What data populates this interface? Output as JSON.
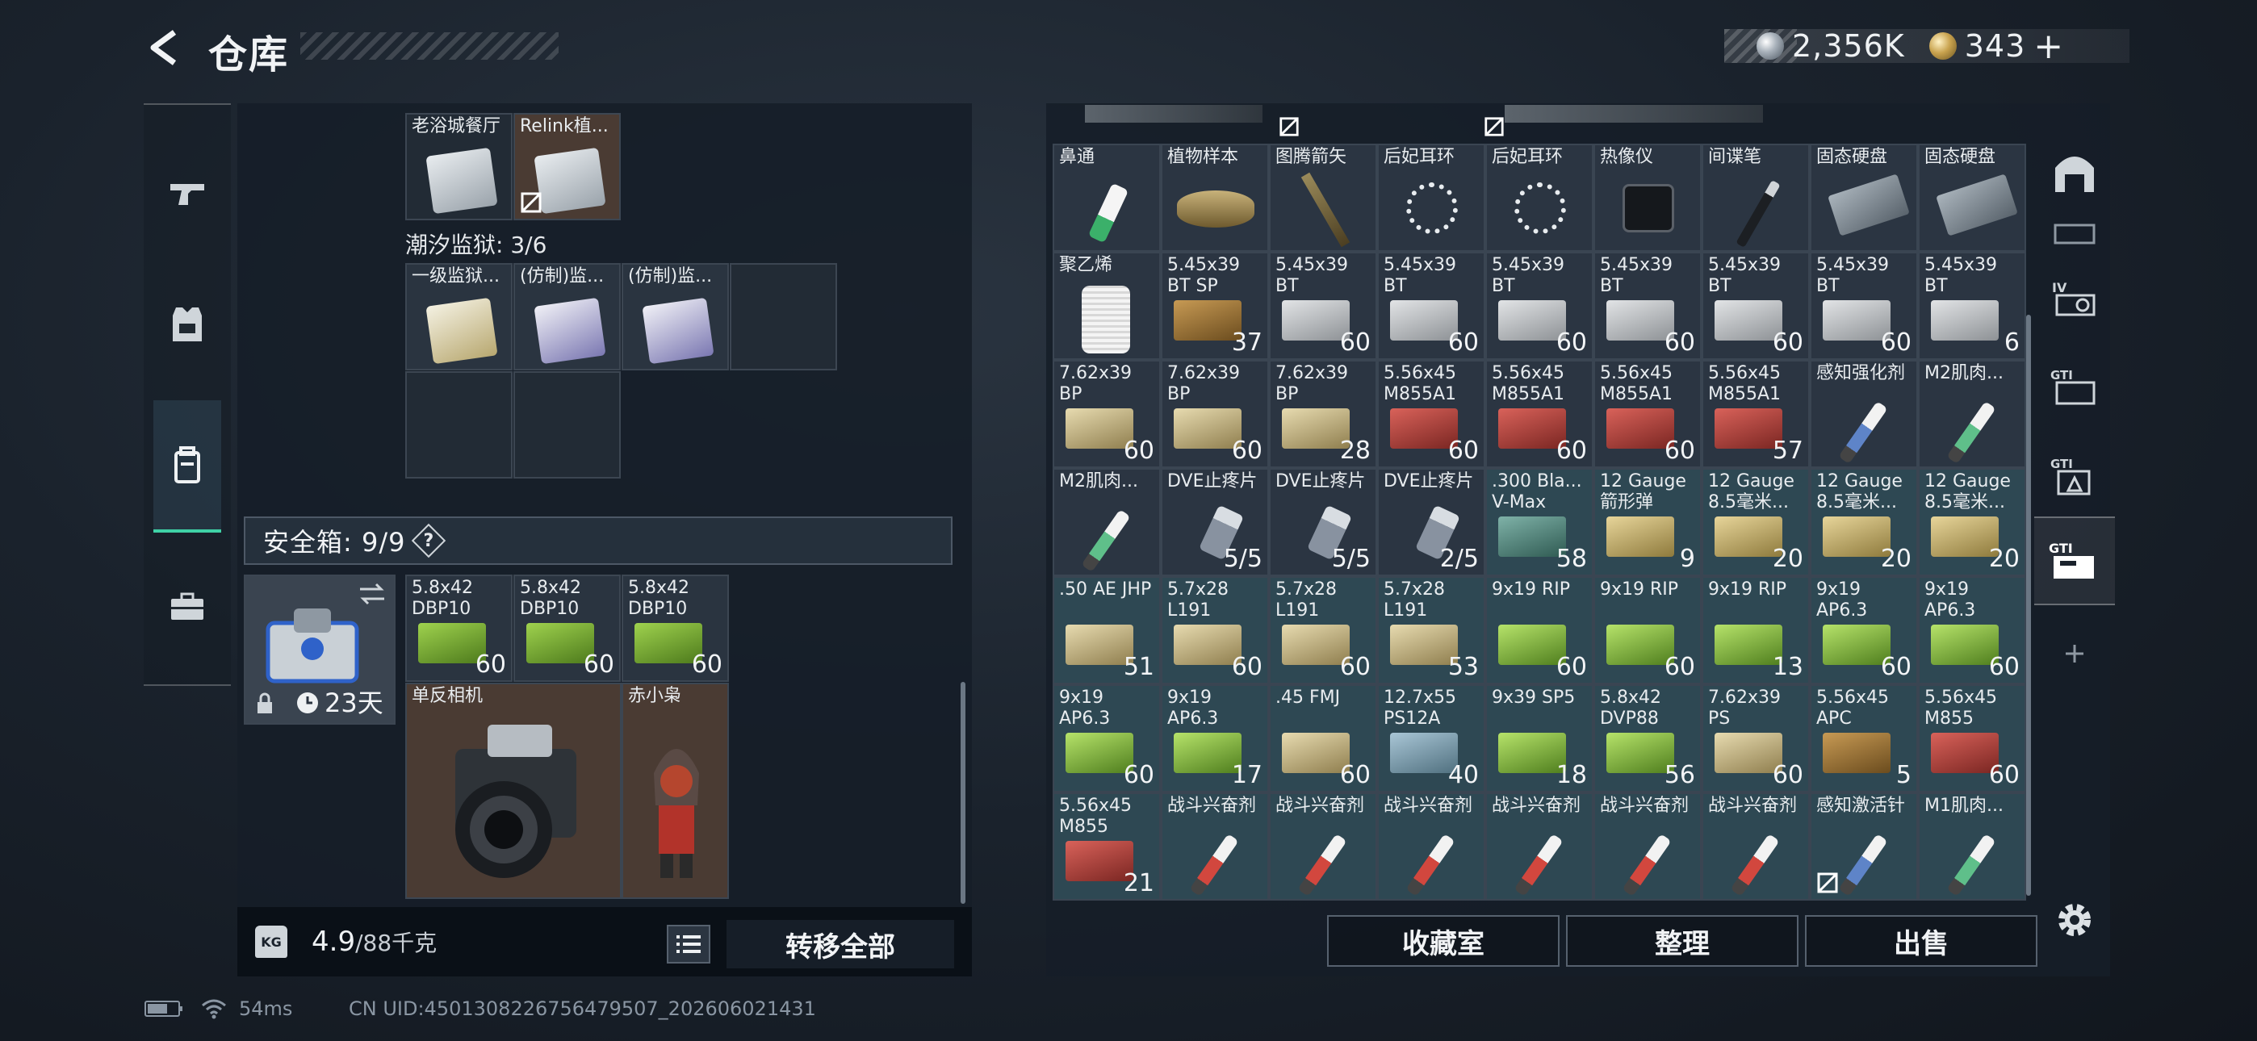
{
  "header": {
    "title": "仓库",
    "currency_silver": "2,356K",
    "currency_gold": "343",
    "plus": "+"
  },
  "left_sidebar": {
    "items": [
      {
        "icon": "pistol-icon"
      },
      {
        "icon": "armor-vest-icon"
      },
      {
        "icon": "backpack-icon",
        "active": true
      },
      {
        "icon": "briefcase-icon"
      }
    ]
  },
  "left": {
    "row1": [
      {
        "name": "老浴城餐厅",
        "bg": "blank"
      },
      {
        "name": "Relink植...",
        "bg": "brown",
        "blocked": true
      }
    ],
    "prison_label": "潮汐监狱: 3/6",
    "prison": [
      {
        "name": "一级监狱..."
      },
      {
        "name": "(仿制)监..."
      },
      {
        "name": "(仿制)监..."
      }
    ],
    "safebox_label": "安全箱: 9/9",
    "safebox_help": "?",
    "safebox_timer": "23天",
    "safe_items_row1": [
      {
        "name": "5.8x42 DBP10",
        "count": "60"
      },
      {
        "name": "5.8x42 DBP10",
        "count": "60"
      },
      {
        "name": "5.8x42 DBP10",
        "count": "60"
      }
    ],
    "camera": "单反相机",
    "figure": "赤小枭"
  },
  "bottom": {
    "weight_value": "4.9",
    "weight_max": "/88千克",
    "transfer_all": "转移全部",
    "kg": "KG"
  },
  "right": {
    "rows": [
      [
        {
          "name": "鼻通",
          "count": "",
          "kind": "bottle"
        },
        {
          "name": "植物样本",
          "count": "",
          "kind": "jar"
        },
        {
          "name": "图腾箭矢",
          "count": "",
          "kind": "arrow"
        },
        {
          "name": "后妃耳环",
          "count": "",
          "kind": "earring"
        },
        {
          "name": "后妃耳环",
          "count": "",
          "kind": "earring"
        },
        {
          "name": "热像仪",
          "count": "",
          "kind": "thermal"
        },
        {
          "name": "间谍笔",
          "count": "",
          "kind": "pen"
        },
        {
          "name": "固态硬盘",
          "count": "",
          "kind": "disk"
        },
        {
          "name": "固态硬盘",
          "count": "",
          "kind": "disk"
        }
      ],
      [
        {
          "name": "聚乙烯",
          "count": "",
          "kind": "spool"
        },
        {
          "name": "5.45x39 BT SP",
          "count": "37",
          "kind": "ammo-rounds"
        },
        {
          "name": "5.45x39 BT",
          "count": "60",
          "kind": "ammo-grey"
        },
        {
          "name": "5.45x39 BT",
          "count": "60",
          "kind": "ammo-grey"
        },
        {
          "name": "5.45x39 BT",
          "count": "60",
          "kind": "ammo-grey"
        },
        {
          "name": "5.45x39 BT",
          "count": "60",
          "kind": "ammo-grey"
        },
        {
          "name": "5.45x39 BT",
          "count": "60",
          "kind": "ammo-grey"
        },
        {
          "name": "5.45x39 BT",
          "count": "60",
          "kind": "ammo-grey"
        },
        {
          "name": "5.45x39 BT",
          "count": "6",
          "kind": "ammo-grey"
        }
      ],
      [
        {
          "name": "7.62x39 BP",
          "count": "60",
          "kind": "ammo-tan"
        },
        {
          "name": "7.62x39 BP",
          "count": "60",
          "kind": "ammo-tan"
        },
        {
          "name": "7.62x39 BP",
          "count": "28",
          "kind": "ammo-tan"
        },
        {
          "name": "5.56x45 M855A1",
          "count": "60",
          "kind": "ammo-red"
        },
        {
          "name": "5.56x45 M855A1",
          "count": "60",
          "kind": "ammo-red"
        },
        {
          "name": "5.56x45 M855A1",
          "count": "60",
          "kind": "ammo-red"
        },
        {
          "name": "5.56x45 M855A1",
          "count": "57",
          "kind": "ammo-red"
        },
        {
          "name": "感知强化剂",
          "count": "",
          "kind": "injector-blue"
        },
        {
          "name": "M2肌肉...",
          "count": "",
          "kind": "injector-green"
        }
      ],
      [
        {
          "name": "M2肌肉...",
          "count": "",
          "kind": "injector-green"
        },
        {
          "name": "DVE止疼片",
          "count": "5/5",
          "kind": "pills"
        },
        {
          "name": "DVE止疼片",
          "count": "5/5",
          "kind": "pills"
        },
        {
          "name": "DVE止疼片",
          "count": "2/5",
          "kind": "pills"
        },
        {
          "name": ".300 Bla... V-Max",
          "count": "58",
          "kind": "ammo-teal",
          "teal": true
        },
        {
          "name": "12 Gauge 箭形弹",
          "count": "9",
          "kind": "ammo-shell",
          "teal": true
        },
        {
          "name": "12 Gauge 8.5毫米...",
          "count": "20",
          "kind": "ammo-shell",
          "teal": true
        },
        {
          "name": "12 Gauge 8.5毫米...",
          "count": "20",
          "kind": "ammo-shell",
          "teal": true
        },
        {
          "name": "12 Gauge 8.5毫米...",
          "count": "20",
          "kind": "ammo-shell",
          "teal": true
        }
      ],
      [
        {
          "name": ".50 AE JHP",
          "count": "51",
          "kind": "ammo-tan",
          "teal": true
        },
        {
          "name": "5.7x28 L191",
          "count": "60",
          "kind": "ammo-tan",
          "teal": true
        },
        {
          "name": "5.7x28 L191",
          "count": "60",
          "kind": "ammo-tan",
          "teal": true
        },
        {
          "name": "5.7x28 L191",
          "count": "53",
          "kind": "ammo-tan",
          "teal": true
        },
        {
          "name": "9x19 RIP",
          "count": "60",
          "kind": "ammo-green",
          "teal": true
        },
        {
          "name": "9x19 RIP",
          "count": "60",
          "kind": "ammo-green",
          "teal": true
        },
        {
          "name": "9x19 RIP",
          "count": "13",
          "kind": "ammo-green",
          "teal": true
        },
        {
          "name": "9x19 AP6.3",
          "count": "60",
          "kind": "ammo-green",
          "teal": true
        },
        {
          "name": "9x19 AP6.3",
          "count": "60",
          "kind": "ammo-green",
          "teal": true
        }
      ],
      [
        {
          "name": "9x19 AP6.3",
          "count": "60",
          "kind": "ammo-green",
          "teal": true
        },
        {
          "name": "9x19 AP6.3",
          "count": "17",
          "kind": "ammo-green",
          "teal": true
        },
        {
          "name": ".45 FMJ",
          "count": "60",
          "kind": "ammo-tan",
          "teal": true
        },
        {
          "name": "12.7x55 PS12A",
          "count": "40",
          "kind": "ammo-blue",
          "teal": true
        },
        {
          "name": "9x39 SP5",
          "count": "18",
          "kind": "ammo-green",
          "teal": true
        },
        {
          "name": "5.8x42 DVP88",
          "count": "56",
          "kind": "ammo-green",
          "teal": true
        },
        {
          "name": "7.62x39 PS",
          "count": "60",
          "kind": "ammo-tan",
          "teal": true
        },
        {
          "name": "5.56x45 APC",
          "count": "5",
          "kind": "ammo-rounds",
          "teal": true
        },
        {
          "name": "5.56x45 M855",
          "count": "60",
          "kind": "ammo-red",
          "teal": true
        }
      ],
      [
        {
          "name": "5.56x45 M855",
          "count": "21",
          "kind": "ammo-red",
          "teal": true
        },
        {
          "name": "战斗兴奋剂",
          "count": "",
          "kind": "injector-red",
          "teal": true
        },
        {
          "name": "战斗兴奋剂",
          "count": "",
          "kind": "injector-red",
          "teal": true
        },
        {
          "name": "战斗兴奋剂",
          "count": "",
          "kind": "injector-red",
          "teal": true
        },
        {
          "name": "战斗兴奋剂",
          "count": "",
          "kind": "injector-red",
          "teal": true
        },
        {
          "name": "战斗兴奋剂",
          "count": "",
          "kind": "injector-red",
          "teal": true
        },
        {
          "name": "战斗兴奋剂",
          "count": "",
          "kind": "injector-red",
          "teal": true
        },
        {
          "name": "感知激活针",
          "count": "",
          "kind": "injector-blue",
          "teal": true,
          "blocked": true
        },
        {
          "name": "M1肌肉...",
          "count": "",
          "kind": "injector-green",
          "teal": true
        }
      ]
    ],
    "buttons": {
      "collection": "收藏室",
      "sort": "整理",
      "sell": "出售"
    }
  },
  "right_sidebar": {
    "items": [
      {
        "icon": "home-arch-icon"
      },
      {
        "icon": "tier-iv-icon"
      },
      {
        "icon": "gti-crate-icon"
      },
      {
        "icon": "gti-pyramid-icon"
      },
      {
        "icon": "gti-box-active-icon",
        "active": true
      },
      {
        "icon": "plus-icon"
      },
      {
        "icon": "settings-gear-icon"
      }
    ]
  },
  "status": {
    "ping": "54ms",
    "uid": "CN UID:4501308226756479507_202606021431"
  },
  "colors": {
    "accent": "#3fd1a6",
    "ammo_green": "#7fbf3a",
    "ammo_red": "#b8403a",
    "ammo_tan": "#c9b98e",
    "ammo_grey": "#b9bcbf"
  }
}
